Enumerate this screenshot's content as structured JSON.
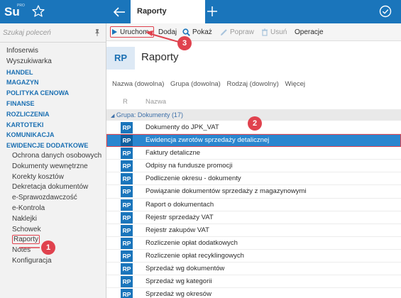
{
  "app": {
    "logo_text": "Su",
    "logo_sub": "PRO",
    "active_tab": "Raporty"
  },
  "sidebar": {
    "search_placeholder": "Szukaj poleceń",
    "items": [
      {
        "label": "Infoserwis",
        "kind": "item"
      },
      {
        "label": "Wyszukiwarka",
        "kind": "item"
      },
      {
        "label": "HANDEL",
        "kind": "section"
      },
      {
        "label": "MAGAZYN",
        "kind": "section"
      },
      {
        "label": "POLITYKA CENOWA",
        "kind": "section"
      },
      {
        "label": "FINANSE",
        "kind": "section"
      },
      {
        "label": "ROZLICZENIA",
        "kind": "section"
      },
      {
        "label": "KARTOTEKI",
        "kind": "section"
      },
      {
        "label": "KOMUNIKACJA",
        "kind": "section"
      },
      {
        "label": "EWIDENCJE DODATKOWE",
        "kind": "section"
      },
      {
        "label": "Ochrona danych osobowych",
        "kind": "sub"
      },
      {
        "label": "Dokumenty wewnętrzne",
        "kind": "sub"
      },
      {
        "label": "Korekty kosztów",
        "kind": "sub"
      },
      {
        "label": "Dekretacja dokumentów",
        "kind": "sub"
      },
      {
        "label": "e-Sprawozdawczość",
        "kind": "sub"
      },
      {
        "label": "e-Kontrola",
        "kind": "sub"
      },
      {
        "label": "Naklejki",
        "kind": "sub"
      },
      {
        "label": "Schowek",
        "kind": "sub"
      },
      {
        "label": "Raporty",
        "kind": "sub",
        "highlighted": true
      },
      {
        "label": "Notes",
        "kind": "sub"
      },
      {
        "label": "Konfiguracja",
        "kind": "sub"
      }
    ]
  },
  "toolbar": {
    "run_label": "Uruchom",
    "add_label": "Dodaj",
    "show_label": "Pokaż",
    "edit_label": "Popraw",
    "delete_label": "Usuń",
    "ops_label": "Operacje"
  },
  "header": {
    "badge": "RP",
    "title": "Raporty"
  },
  "filters": {
    "name": "Nazwa (dowolna)",
    "group": "Grupa (dowolna)",
    "kind": "Rodzaj (dowolny)",
    "more": "Więcej"
  },
  "columns": {
    "r": "R",
    "name": "Nazwa"
  },
  "group": {
    "label": "Grupa: Dokumenty (17)"
  },
  "rows": [
    {
      "icon": "RP",
      "name": "Dokumenty do JPK_VAT"
    },
    {
      "icon": "RP",
      "name": "Ewidencja zwrotów sprzedaży detalicznej",
      "selected": true
    },
    {
      "icon": "RP",
      "name": "Faktury detaliczne"
    },
    {
      "icon": "RP",
      "name": "Odpisy na fundusze promocji"
    },
    {
      "icon": "RP",
      "name": "Podliczenie okresu - dokumenty"
    },
    {
      "icon": "RP",
      "name": "Powiązanie dokumentów sprzedaży z magazynowymi"
    },
    {
      "icon": "RP",
      "name": "Raport o dokumentach"
    },
    {
      "icon": "RP",
      "name": "Rejestr sprzedaży VAT"
    },
    {
      "icon": "RP",
      "name": "Rejestr zakupów VAT"
    },
    {
      "icon": "RP",
      "name": "Rozliczenie opłat dodatkowych"
    },
    {
      "icon": "RP",
      "name": "Rozliczenie opłat recyklingowych"
    },
    {
      "icon": "RP",
      "name": "Sprzedaż wg dokumentów"
    },
    {
      "icon": "RP",
      "name": "Sprzedaż wg kategorii"
    },
    {
      "icon": "RP",
      "name": "Sprzedaż wg okresów"
    }
  ],
  "annotations": {
    "step1": "1",
    "step2": "2",
    "step3": "3",
    "color": "#e0424e"
  },
  "colors": {
    "brand": "#1a75bb",
    "selected_row": "#2a86cf",
    "section_text": "#1a6fb2"
  }
}
